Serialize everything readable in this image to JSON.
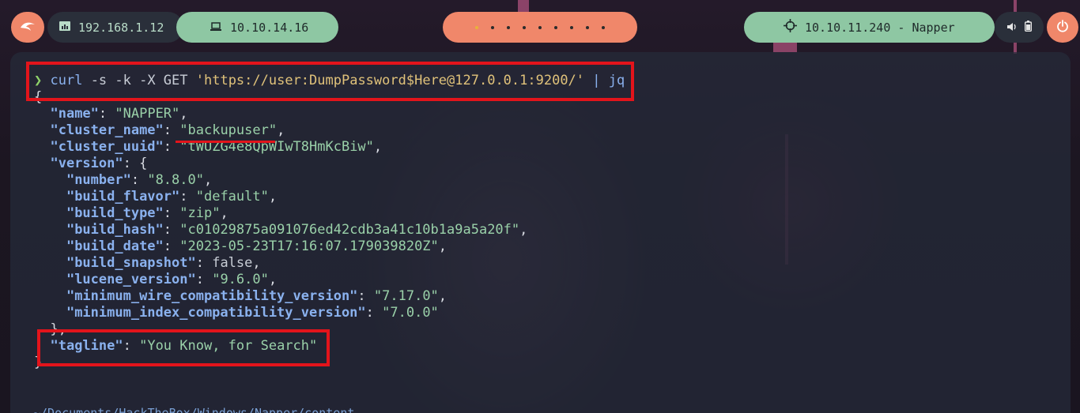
{
  "topbar": {
    "ip_local": "192.168.1.12",
    "ip_vpn": "10.10.14.16",
    "target": "10.10.11.240 - Napper",
    "workspace_count": 9,
    "icons": {
      "logo": "kali-dragon-icon",
      "ip_local": "network-icon",
      "ip_vpn": "laptop-icon",
      "target": "crosshair-icon",
      "volume": "volume-icon",
      "battery": "battery-icon",
      "power": "power-icon"
    }
  },
  "terminal": {
    "prompt_symbol": "❯",
    "command": {
      "cmd": "curl",
      "flags": " -s -k -X GET ",
      "url": "'https://user:DumpPassword$Here@127.0.0.1:9200/'",
      "pipe": " | ",
      "pipe_cmd": "jq"
    },
    "output": {
      "open_brace": "{",
      "name_key": "\"name\"",
      "name_val": "\"NAPPER\"",
      "cluster_name_key": "\"cluster_name\"",
      "cluster_name_val": "\"backupuser\"",
      "cluster_uuid_key": "\"cluster_uuid\"",
      "cluster_uuid_val": "\"tWUZG4e8QpWIwT8HmKcBiw\"",
      "version_key": "\"version\"",
      "number_key": "\"number\"",
      "number_val": "\"8.8.0\"",
      "build_flavor_key": "\"build_flavor\"",
      "build_flavor_val": "\"default\"",
      "build_type_key": "\"build_type\"",
      "build_type_val": "\"zip\"",
      "build_hash_key": "\"build_hash\"",
      "build_hash_val": "\"c01029875a091076ed42cdb3a41c10b1a9a5a20f\"",
      "build_date_key": "\"build_date\"",
      "build_date_val": "\"2023-05-23T17:16:07.179039820Z\"",
      "build_snapshot_key": "\"build_snapshot\"",
      "build_snapshot_val": "false",
      "lucene_version_key": "\"lucene_version\"",
      "lucene_version_val": "\"9.6.0\"",
      "min_wire_key": "\"minimum_wire_compatibility_version\"",
      "min_wire_val": "\"7.17.0\"",
      "min_index_key": "\"minimum_index_compatibility_version\"",
      "min_index_val": "\"7.0.0\"",
      "version_close": "},",
      "tagline_key": "\"tagline\"",
      "tagline_val": "\"You Know, for Search\"",
      "close_brace": "}"
    },
    "bottom_prompt": "~/Documents/HackTheBox/Windows/Napper/content"
  },
  "colors": {
    "highlight": "#e3141b",
    "accent_orange": "#f0876a",
    "accent_green": "#8ec7a3"
  }
}
